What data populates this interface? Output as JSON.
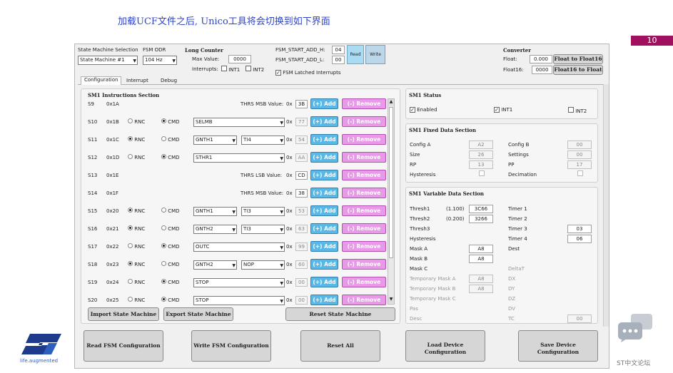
{
  "slide": {
    "title": "加载UCF文件之后, Unico工具将会切换到如下界面",
    "page_number": "10"
  },
  "top": {
    "sm_selection_label": "State Machine Selection",
    "sm_selection_value": "State Machine #1",
    "fsm_odr_label": "FSM ODR",
    "fsm_odr_value": "104 Hz",
    "long_counter_label": "Long Counter",
    "max_value_label": "Max Value:",
    "max_value": "0000",
    "interrupts_label": "Interrupts:",
    "int1": "INT1",
    "int2": "INT2",
    "start_add_h_label": "FSM_START_ADD_H:",
    "start_add_h": "04",
    "start_add_l_label": "FSM_START_ADD_L:",
    "start_add_l": "00",
    "read_btn": "Read",
    "write_btn": "Write",
    "latched_label": "FSM Latched Interrupts",
    "converter_label": "Converter",
    "float_label": "Float:",
    "float_value": "0.000",
    "float_to_f16": "Float to Float16",
    "float16_label": "Float16:",
    "float16_value": "0000",
    "f16_to_float": "Float16 to Float"
  },
  "tabs": [
    "Configuration",
    "Interrupt",
    "Debug"
  ],
  "instructions": {
    "section_title": "SM1 Instructions Section",
    "add_label": "(+) Add",
    "remove_label": "(-) Remove",
    "ox": "0x",
    "rows": [
      {
        "s": "S9",
        "addr": "0x1A",
        "kind": "thrs",
        "label": "THRS MSB Value:",
        "val": "3B"
      },
      {
        "s": "S10",
        "addr": "0x1B",
        "kind": "cmd",
        "rnc": false,
        "c1": "SELMB",
        "val": "77"
      },
      {
        "s": "S11",
        "addr": "0x1C",
        "kind": "rnc",
        "rnc": true,
        "c1": "GNTH1",
        "c2": "TI4",
        "val": "54"
      },
      {
        "s": "S12",
        "addr": "0x1D",
        "kind": "cmd",
        "rnc": false,
        "c1": "STHR1",
        "val": "AA"
      },
      {
        "s": "S13",
        "addr": "0x1E",
        "kind": "thrs",
        "label": "THRS LSB Value:",
        "val": "CD"
      },
      {
        "s": "S14",
        "addr": "0x1F",
        "kind": "thrs",
        "label": "THRS MSB Value:",
        "val": "38"
      },
      {
        "s": "S15",
        "addr": "0x20",
        "kind": "rnc",
        "rnc": true,
        "c1": "GNTH1",
        "c2": "TI3",
        "val": "53"
      },
      {
        "s": "S16",
        "addr": "0x21",
        "kind": "rnc",
        "rnc": true,
        "c1": "GNTH2",
        "c2": "TI3",
        "val": "63"
      },
      {
        "s": "S17",
        "addr": "0x22",
        "kind": "cmd",
        "rnc": false,
        "c1": "OUTC",
        "val": "99"
      },
      {
        "s": "S18",
        "addr": "0x23",
        "kind": "rnc",
        "rnc": true,
        "c1": "GNTH2",
        "c2": "NOP",
        "val": "60"
      },
      {
        "s": "S19",
        "addr": "0x24",
        "kind": "cmd",
        "rnc": false,
        "c1": "STOP",
        "val": "00"
      },
      {
        "s": "S20",
        "addr": "0x25",
        "kind": "cmd",
        "rnc": false,
        "c1": "STOP",
        "val": "00"
      }
    ],
    "rnc_label": "RNC",
    "cmd_label": "CMD",
    "import_btn": "Import State Machine",
    "export_btn": "Export State Machine",
    "reset_btn": "Reset State Machine"
  },
  "status": {
    "title": "SM1 Status",
    "enabled": "Enabled",
    "int1": "INT1",
    "int2": "INT2"
  },
  "fixed": {
    "title": "SM1 Fixed Data Section",
    "config_a": "Config A",
    "config_a_val": "A2",
    "config_b": "Config B",
    "config_b_val": "00",
    "size": "Size",
    "size_val": "26",
    "settings": "Settings",
    "settings_val": "00",
    "rp": "RP",
    "rp_val": "13",
    "pp": "PP",
    "pp_val": "17",
    "hysteresis": "Hysteresis",
    "decimation": "Decimation"
  },
  "variable": {
    "title": "SM1 Variable Data Section",
    "thresh1": "Thresh1",
    "thresh1_hint": "(1.100)",
    "thresh1_val": "3C66",
    "thresh2": "Thresh2",
    "thresh2_hint": "(0.200)",
    "thresh2_val": "3266",
    "thresh3": "Thresh3",
    "hysteresis": "Hysteresis",
    "mask_a": "Mask A",
    "mask_a_val": "A8",
    "mask_b": "Mask B",
    "mask_b_val": "A8",
    "mask_c": "Mask C",
    "tmask_a": "Temporary Mask A",
    "tmask_a_val": "A8",
    "tmask_b": "Temporary Mask B",
    "tmask_b_val": "A8",
    "tmask_c": "Temporary Mask C",
    "pas": "Pas",
    "desc": "Desc",
    "timer1": "Timer 1",
    "timer2": "Timer 2",
    "timer3": "Timer 3",
    "timer3_val": "03",
    "timer4": "Timer 4",
    "timer4_val": "06",
    "dest": "Dest",
    "deltat": "DeltaT",
    "dx": "DX",
    "dy": "DY",
    "dz": "DZ",
    "dv": "DV",
    "tc": "TC",
    "tc_val": "00"
  },
  "bottom": {
    "read": "Read FSM Configuration",
    "write": "Write FSM Configuration",
    "reset": "Reset All",
    "load": "Load Device Configuration",
    "save": "Save Device Configuration"
  },
  "logo": {
    "tagline": "life.augmented"
  },
  "forum": {
    "label": "ST中文论坛"
  },
  "colors": {
    "title": "#2d44c8",
    "page_badge": "#a0105e",
    "add": "#5ab8e6",
    "remove": "#e89ae8"
  }
}
